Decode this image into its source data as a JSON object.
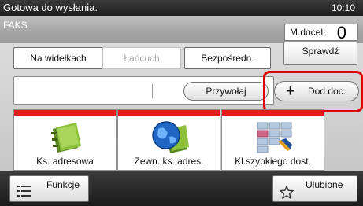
{
  "status": {
    "message": "Gotowa do wysłania.",
    "time": "10:10"
  },
  "header": {
    "title": "FAKS",
    "destinations_label": "M.docel:",
    "destinations_count": "0"
  },
  "modes": {
    "on_hook": "Na widełkach",
    "chain": "Łańcuch",
    "direct": "Bezpośredn."
  },
  "check_button": "Sprawdź",
  "destination": {
    "value": "",
    "recall_button": "Przywołaj",
    "add_button": "Dod.doc."
  },
  "tiles": [
    {
      "label": "Ks. adresowa",
      "icon": "address-book-icon"
    },
    {
      "label": "Zewn. ks. adres.",
      "icon": "external-address-book-icon"
    },
    {
      "label": "Kl.szybkiego dost.",
      "icon": "one-touch-key-icon"
    }
  ],
  "footer": {
    "functions_label": "Funkcje",
    "favorites_label": "Ulubione"
  },
  "colors": {
    "highlight": "#e00000",
    "tile_stripe": "#e31b1b"
  }
}
